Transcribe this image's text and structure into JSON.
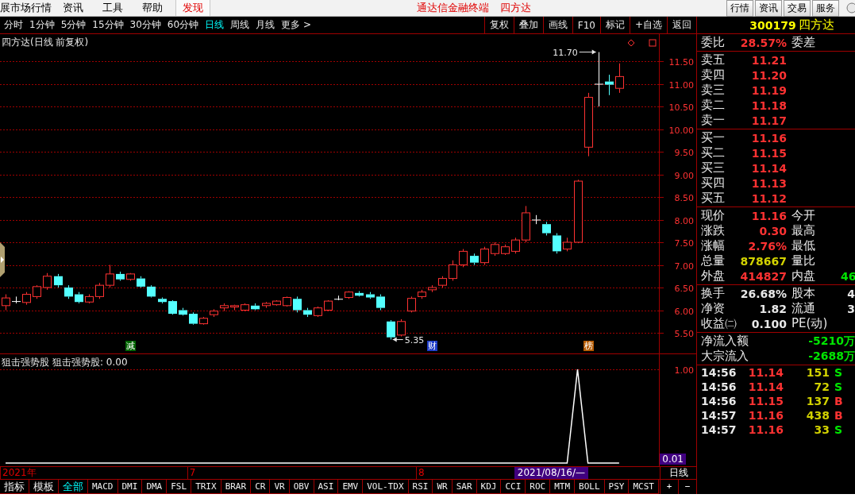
{
  "menu_bar": {
    "items": [
      {
        "label": "展市场行情",
        "selected": false
      },
      {
        "label": "资讯",
        "selected": false
      },
      {
        "label": "工具",
        "selected": false
      },
      {
        "label": "帮助",
        "selected": false
      },
      {
        "label": "发现",
        "selected": true
      }
    ],
    "app_title": "通达信金融终端",
    "stock_name": "四方达",
    "buttons": [
      "行情",
      "资讯",
      "交易",
      "服务"
    ]
  },
  "period_bar": {
    "periods": [
      {
        "label": "分时",
        "selected": false
      },
      {
        "label": "1分钟",
        "selected": false
      },
      {
        "label": "5分钟",
        "selected": false
      },
      {
        "label": "15分钟",
        "selected": false
      },
      {
        "label": "30分钟",
        "selected": false
      },
      {
        "label": "60分钟",
        "selected": false
      },
      {
        "label": "日线",
        "selected": true
      },
      {
        "label": "周线",
        "selected": false
      },
      {
        "label": "月线",
        "selected": false
      },
      {
        "label": "更多 >",
        "selected": false
      }
    ],
    "tools": [
      "复权",
      "叠加",
      "画线",
      "F10",
      "标记",
      "+自选",
      "返回"
    ]
  },
  "price_chart": {
    "title": "四方达(日线 前复权)",
    "axis_labels": [
      "11.50",
      "11.00",
      "10.50",
      "10.00",
      "9.50",
      "9.00",
      "8.50",
      "8.00",
      "7.50",
      "7.00",
      "6.50",
      "6.00",
      "5.50"
    ],
    "annotations": [
      {
        "label": "11.70",
        "kind": "high"
      },
      {
        "label": "5.35",
        "kind": "low"
      }
    ],
    "events": [
      {
        "label": "减",
        "color": "#006400"
      },
      {
        "label": "财",
        "color": "#1e3cc8"
      },
      {
        "label": "榜",
        "color": "#b45a00"
      }
    ]
  },
  "indicator": {
    "name": "狙击强势股",
    "reading": "狙击强势股: 0.00",
    "axis_label": "1.00",
    "cursor_value": "0.01"
  },
  "date_axis": {
    "labels": [
      "2021年",
      "7",
      "8"
    ],
    "cursor_date": "2021/08/16/—",
    "period": "日线"
  },
  "indicator_tabs": [
    {
      "label": "指标",
      "selected": false
    },
    {
      "label": "模板",
      "selected": false
    },
    {
      "label": "全部",
      "selected": true
    },
    {
      "label": "MACD",
      "selected": false
    },
    {
      "label": "DMI",
      "selected": false
    },
    {
      "label": "DMA",
      "selected": false
    },
    {
      "label": "FSL",
      "selected": false
    },
    {
      "label": "TRIX",
      "selected": false
    },
    {
      "label": "BRAR",
      "selected": false
    },
    {
      "label": "CR",
      "selected": false
    },
    {
      "label": "VR",
      "selected": false
    },
    {
      "label": "OBV",
      "selected": false
    },
    {
      "label": "ASI",
      "selected": false
    },
    {
      "label": "EMV",
      "selected": false
    },
    {
      "label": "VOL-TDX",
      "selected": false
    },
    {
      "label": "RSI",
      "selected": false
    },
    {
      "label": "WR",
      "selected": false
    },
    {
      "label": "SAR",
      "selected": false
    },
    {
      "label": "KDJ",
      "selected": false
    },
    {
      "label": "CCI",
      "selected": false
    },
    {
      "label": "ROC",
      "selected": false
    },
    {
      "label": "MTM",
      "selected": false
    },
    {
      "label": "BOLL",
      "selected": false
    },
    {
      "label": "PSY",
      "selected": false
    },
    {
      "label": "MCST",
      "selected": false
    }
  ],
  "zoom_buttons": [
    "+",
    "−"
  ],
  "quote_panel": {
    "code": "300179",
    "name": "四方达",
    "ratio": {
      "cells": [
        {
          "text": "委比"
        },
        {
          "text": "28.57%",
          "color": "#ff3232"
        },
        {
          "text": "委差"
        }
      ]
    },
    "asks": [
      {
        "label": "卖五",
        "price": "11.21"
      },
      {
        "label": "卖四",
        "price": "11.20"
      },
      {
        "label": "卖三",
        "price": "11.19"
      },
      {
        "label": "卖二",
        "price": "11.18"
      },
      {
        "label": "卖一",
        "price": "11.17"
      }
    ],
    "bids": [
      {
        "label": "买一",
        "price": "11.16"
      },
      {
        "label": "买二",
        "price": "11.15"
      },
      {
        "label": "买三",
        "price": "11.14"
      },
      {
        "label": "买四",
        "price": "11.13"
      },
      {
        "label": "买五",
        "price": "11.12"
      }
    ],
    "stats": [
      {
        "cells": [
          {
            "text": "现价"
          },
          {
            "text": "11.16",
            "color": "#ff3232"
          },
          {
            "text": "今开"
          }
        ]
      },
      {
        "cells": [
          {
            "text": "涨跌"
          },
          {
            "text": "0.30",
            "color": "#ff3232"
          },
          {
            "text": "最高"
          }
        ]
      },
      {
        "cells": [
          {
            "text": "涨幅"
          },
          {
            "text": "2.76%",
            "color": "#ff3232"
          },
          {
            "text": "最低"
          }
        ]
      },
      {
        "cells": [
          {
            "text": "总量"
          },
          {
            "text": "878667",
            "color": "#d2d200"
          },
          {
            "text": "量比"
          }
        ]
      },
      {
        "cells": [
          {
            "text": "外盘"
          },
          {
            "text": "414827",
            "color": "#ff3232"
          },
          {
            "text": "内盘"
          },
          {
            "text": "46",
            "color": "#00e600"
          }
        ]
      }
    ],
    "finance": [
      {
        "cells": [
          {
            "text": "换手"
          },
          {
            "text": "26.68%",
            "color": "#e8e8e8"
          },
          {
            "text": "股本"
          },
          {
            "text": "4",
            "color": "#e8e8e8"
          }
        ]
      },
      {
        "cells": [
          {
            "text": "净资"
          },
          {
            "text": "1.82",
            "color": "#e8e8e8"
          },
          {
            "text": "流通"
          },
          {
            "text": "3",
            "color": "#e8e8e8"
          }
        ]
      },
      {
        "cells": [
          {
            "text": "收益㈡"
          },
          {
            "text": "0.100",
            "color": "#e8e8e8"
          },
          {
            "text": "PE(动)"
          }
        ]
      }
    ],
    "flows": [
      {
        "label": "净流入额",
        "value": "-5210万"
      },
      {
        "label": "大宗流入",
        "value": "-2688万"
      }
    ],
    "ticks": [
      {
        "time": "14:56",
        "price": "11.14",
        "volume": "151",
        "side": "S",
        "color": "#00e600"
      },
      {
        "time": "14:56",
        "price": "11.14",
        "volume": "72",
        "side": "S",
        "color": "#00e600"
      },
      {
        "time": "14:56",
        "price": "11.15",
        "volume": "137",
        "side": "B",
        "color": "#ff3232"
      },
      {
        "time": "14:57",
        "price": "11.16",
        "volume": "438",
        "side": "B",
        "color": "#ff3232"
      },
      {
        "time": "14:57",
        "price": "11.16",
        "volume": "33",
        "side": "S",
        "color": "#00e600"
      }
    ]
  }
}
